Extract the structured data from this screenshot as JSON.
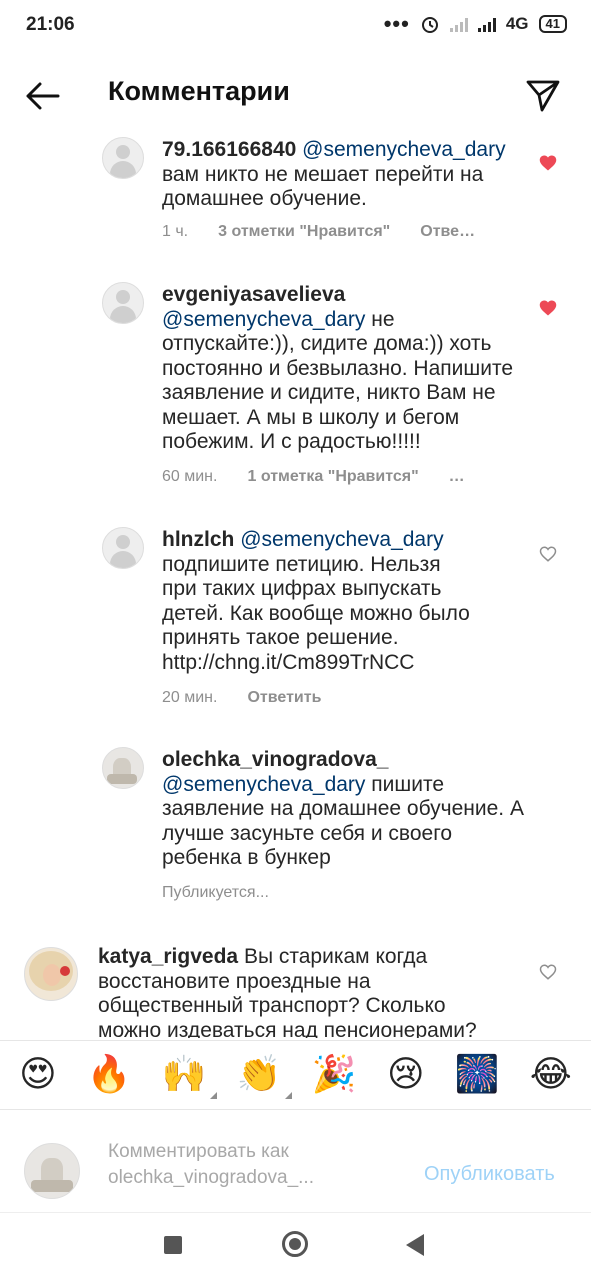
{
  "status_bar": {
    "time": "21:06",
    "network": "4G",
    "battery": "41"
  },
  "header": {
    "title": "Комментарии"
  },
  "comments": [
    {
      "username": "79.166166840",
      "mention": "@semenycheva_dary",
      "text": "вам никто не мешает перейти на домашнее обучение.",
      "time": "1 ч.",
      "likes": "3 отметки \"Нравится\"",
      "reply": "Отве…",
      "liked": true
    },
    {
      "username": "evgeniyasavelieva",
      "mention": "@semenycheva_dary",
      "text": "не отпускайте:)), сидите дома:)) хоть постоянно и безвылазно. Напишите заявление и сидите, никто Вам не мешает. А мы в школу и бегом побежим. И с радостью!!!!!",
      "time": "60 мин.",
      "likes": "1 отметка \"Нравится\"",
      "reply": "…",
      "liked": true
    },
    {
      "username": "hlnzlch",
      "mention": "@semenycheva_dary",
      "text": "подпишите петицию. Нельзя при таких цифрах выпускать детей. Как вообще можно было принять такое решение. http://chng.it/Cm899TrNCC",
      "time": "20 мин.",
      "reply": "Ответить",
      "liked": false
    },
    {
      "username": "olechka_vinogradova_",
      "mention": "@semenycheva_dary",
      "text": "пишите заявление на домашнее обучение. А лучше засуньте себя и своего ребенка в бункер",
      "status": "Публикуется..."
    },
    {
      "username": "katya_rigveda",
      "text": "Вы старикам когда восстановите проездные на общественный транспорт? Сколько можно издеваться над пенсионерами?",
      "liked": false
    }
  ],
  "emoji_bar": [
    "😍",
    "🔥",
    "🙌",
    "👏",
    "🎉",
    "😢",
    "🎆",
    "😂"
  ],
  "composer": {
    "placeholder": "Комментировать как olechka_vinogradova_...",
    "publish_label": "Опубликовать"
  },
  "colors": {
    "heart_liked": "#ed4956",
    "mention": "#00376b",
    "publish_disabled": "#9ed2f7"
  }
}
